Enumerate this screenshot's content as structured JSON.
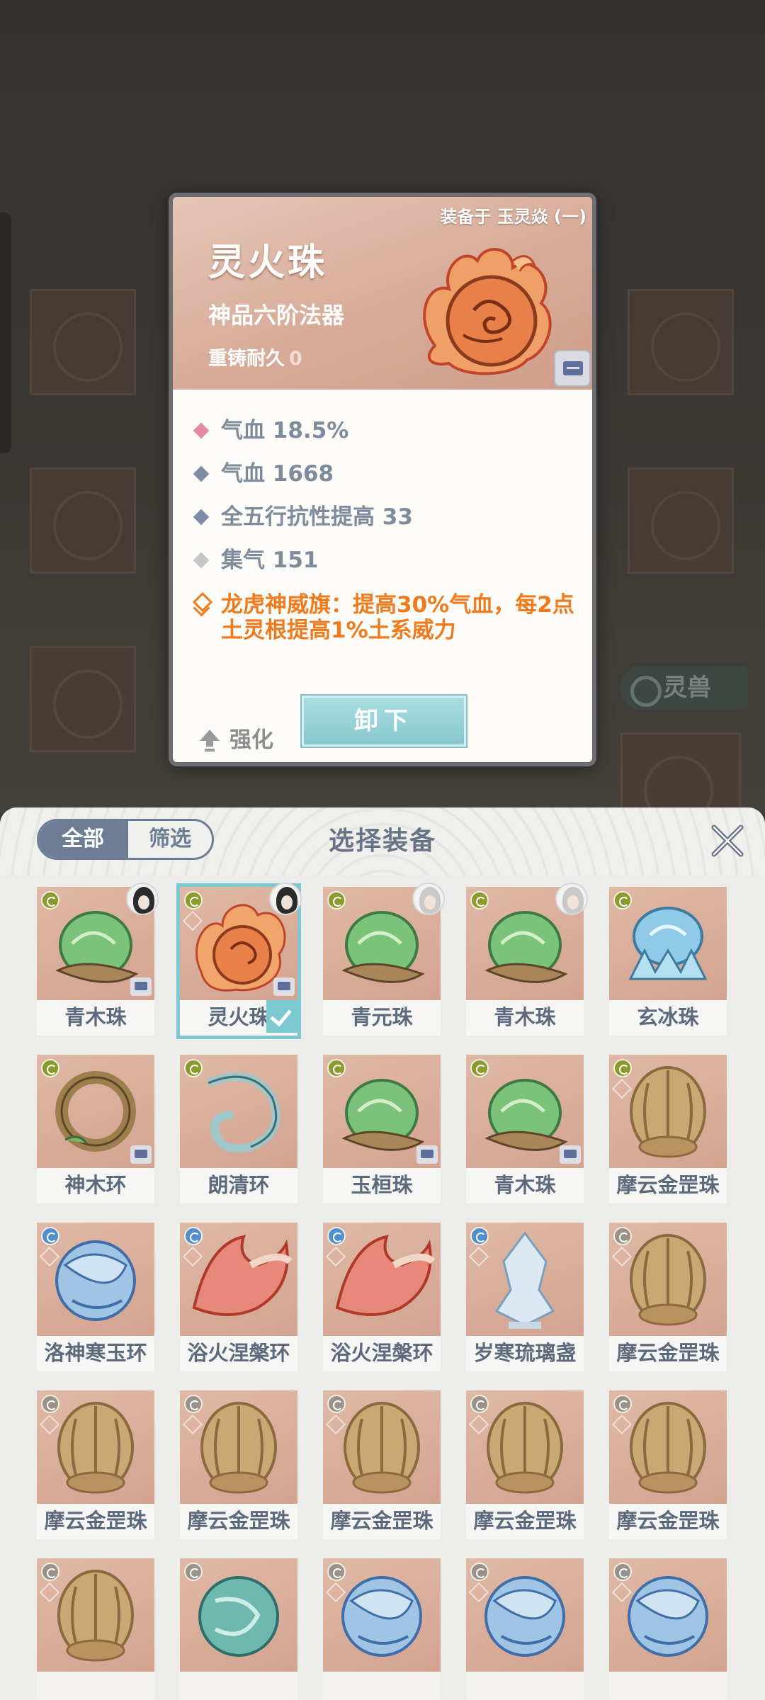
{
  "background": {
    "tab_label": "灵兽"
  },
  "detail_card": {
    "equipped_label": "装备于 玉灵焱 (一)",
    "item_name": "灵火珠",
    "item_grade": "神品六阶法器",
    "durability_label": "重铸耐久",
    "durability_value": "0",
    "stats": [
      {
        "text": "气血 18.5%",
        "kind": "pink"
      },
      {
        "text": "气血 1668",
        "kind": "blue"
      },
      {
        "text": "全五行抗性提高 33",
        "kind": "blue"
      },
      {
        "text": "集气 151",
        "kind": "grey"
      }
    ],
    "special_effect": "龙虎神威旗：提高30%气血，每2点土灵根提高1%土系威力",
    "upgrade_label": "强化",
    "unequip_label": "卸下",
    "colors": {
      "stat_text": "#7d8b9c",
      "special_text": "#f07a1e",
      "accent": "#7cc9d2"
    }
  },
  "panel": {
    "tab_all": "全部",
    "tab_filter": "筛选",
    "title": "选择装备",
    "close_icon": "close-icon",
    "items": [
      {
        "name": "青木珠",
        "art": "green",
        "tier": "green",
        "owner": "dark",
        "lock": true
      },
      {
        "name": "灵火珠",
        "art": "fire",
        "tier": "green",
        "owner": "dark",
        "lock": true,
        "selected": true
      },
      {
        "name": "青元珠",
        "art": "green",
        "tier": "green",
        "owner": "light",
        "lock": false
      },
      {
        "name": "青木珠",
        "art": "green",
        "tier": "green",
        "owner": "light",
        "lock": false
      },
      {
        "name": "玄冰珠",
        "art": "ice",
        "tier": "green",
        "owner": "",
        "lock": false
      },
      {
        "name": "神木环",
        "art": "wood",
        "tier": "green",
        "owner": "",
        "lock": true
      },
      {
        "name": "朗清环",
        "art": "wind",
        "tier": "green",
        "owner": "",
        "lock": false
      },
      {
        "name": "玉桓珠",
        "art": "green",
        "tier": "green",
        "owner": "",
        "lock": true
      },
      {
        "name": "青木珠",
        "art": "green",
        "tier": "green",
        "owner": "",
        "lock": true
      },
      {
        "name": "摩云金罡珠",
        "art": "gold",
        "tier": "green",
        "owner": "",
        "lock": false
      },
      {
        "name": "洛神寒玉环",
        "art": "water",
        "tier": "blue",
        "owner": "",
        "lock": false
      },
      {
        "name": "浴火涅槃环",
        "art": "phoenix",
        "tier": "blue",
        "owner": "",
        "lock": false
      },
      {
        "name": "浴火涅槃环",
        "art": "phoenix",
        "tier": "blue",
        "owner": "",
        "lock": false
      },
      {
        "name": "岁寒琉璃盏",
        "art": "crystal",
        "tier": "blue",
        "owner": "",
        "lock": false
      },
      {
        "name": "摩云金罡珠",
        "art": "gold",
        "tier": "grey",
        "owner": "",
        "lock": false
      },
      {
        "name": "摩云金罡珠",
        "art": "gold",
        "tier": "grey",
        "owner": "",
        "lock": false
      },
      {
        "name": "摩云金罡珠",
        "art": "gold",
        "tier": "grey",
        "owner": "",
        "lock": false
      },
      {
        "name": "摩云金罡珠",
        "art": "gold",
        "tier": "grey",
        "owner": "",
        "lock": false
      },
      {
        "name": "摩云金罡珠",
        "art": "gold",
        "tier": "grey",
        "owner": "",
        "lock": false
      },
      {
        "name": "摩云金罡珠",
        "art": "gold",
        "tier": "grey",
        "owner": "",
        "lock": false
      },
      {
        "name": "",
        "art": "gold",
        "tier": "grey",
        "owner": "",
        "lock": false
      },
      {
        "name": "",
        "art": "jade",
        "tier": "grey",
        "owner": "",
        "lock": false
      },
      {
        "name": "",
        "art": "water",
        "tier": "grey",
        "owner": "",
        "lock": false
      },
      {
        "name": "",
        "art": "water",
        "tier": "grey",
        "owner": "",
        "lock": false
      },
      {
        "name": "",
        "art": "water",
        "tier": "grey",
        "owner": "",
        "lock": false
      }
    ]
  }
}
